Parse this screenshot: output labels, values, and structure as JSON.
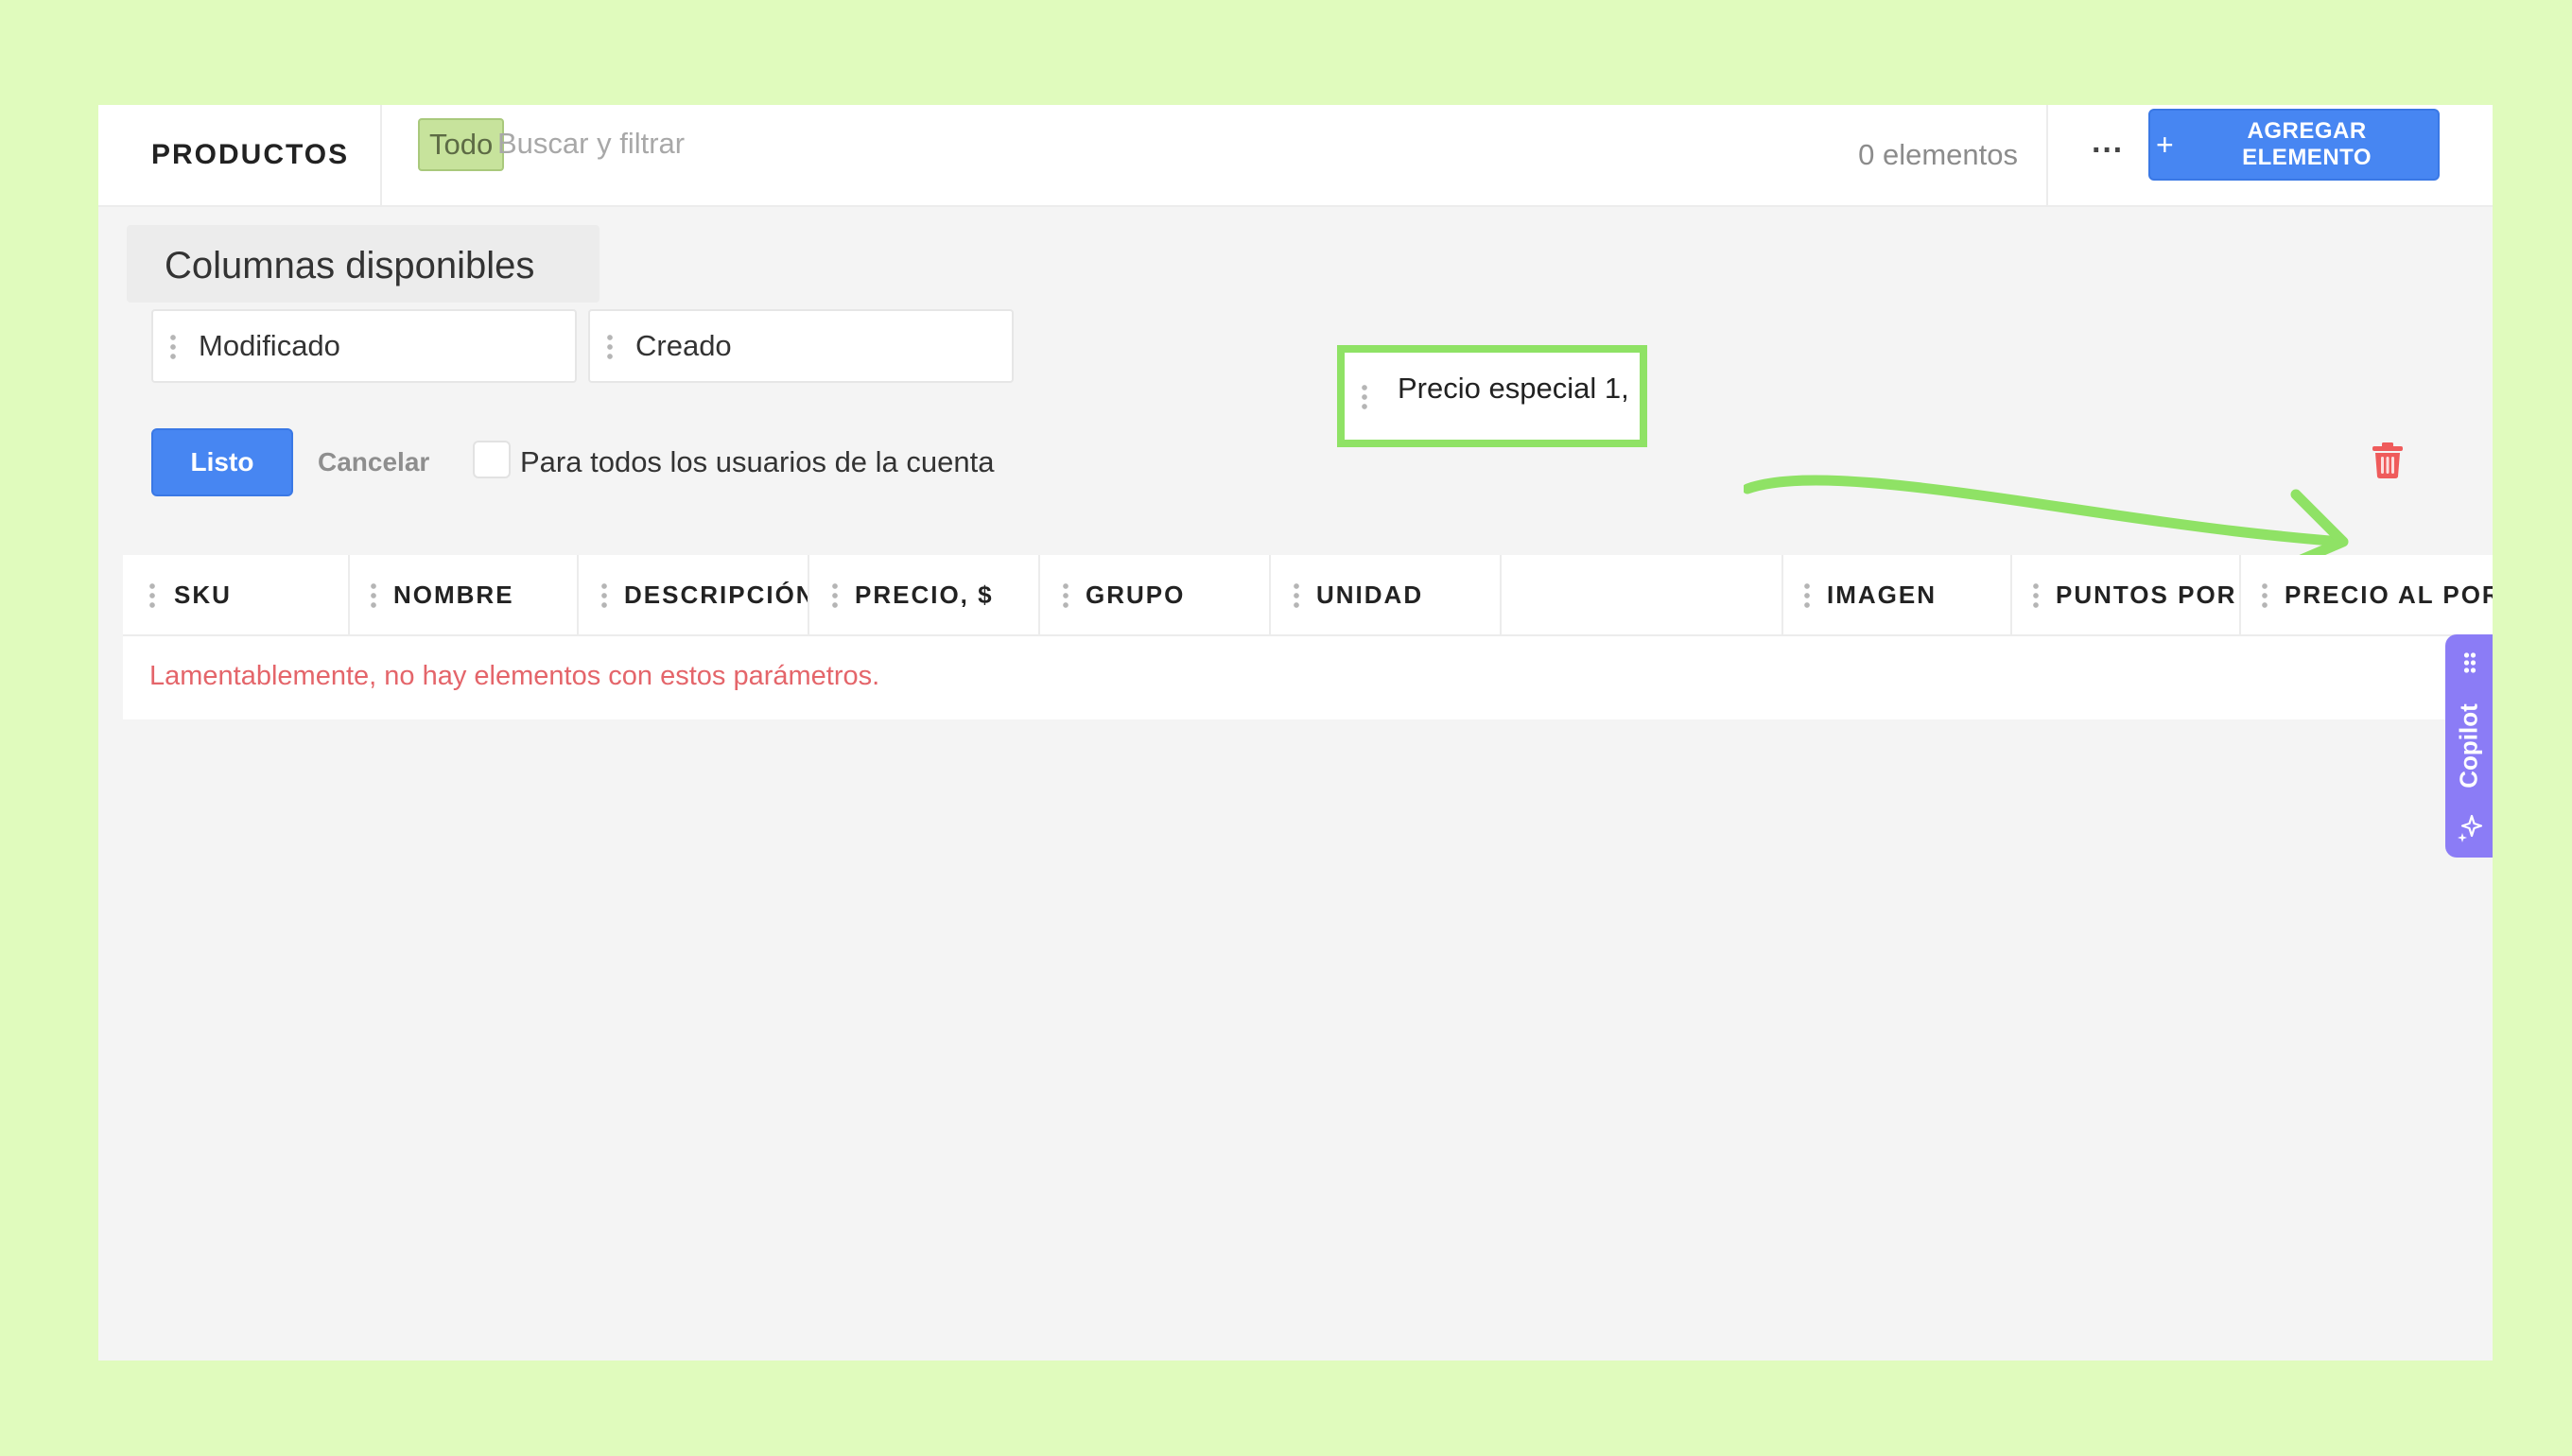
{
  "header": {
    "title": "PRODUCTOS",
    "filter_chip": "Todo",
    "search_placeholder": "Buscar y filtrar",
    "count": "0 elementos",
    "more_label": "···",
    "add_button": "AGREGAR ELEMENTO",
    "add_button_icon": "plus-icon"
  },
  "panel": {
    "title": "Columnas disponibles",
    "available_columns": [
      "Modificado",
      "Creado"
    ],
    "dragging_column": "Precio especial 1,",
    "done_button": "Listo",
    "cancel_button": "Cancelar",
    "all_users_checkbox": {
      "label": "Para todos los usuarios de la cuenta",
      "checked": false
    },
    "trash_icon": "trash-icon"
  },
  "table": {
    "columns": [
      "SKU",
      "NOMBRE",
      "DESCRIPCIÓN",
      "PRECIO, $",
      "GRUPO",
      "UNIDAD",
      "",
      "IMAGEN",
      "PUNTOS POR CO",
      "PRECIO AL POR"
    ],
    "empty_message": "Lamentablemente, no hay elementos con estos parámetros."
  },
  "copilot": {
    "label": "Copilot",
    "icon": "sparkle-icon"
  },
  "colors": {
    "background": "#e0fbbd",
    "primary": "#4786f2",
    "highlight": "#8fe265",
    "error_text": "#e4656a",
    "trash": "#ef5b5b",
    "copilot": "#8b7cf6",
    "chip": "#c7e39c"
  }
}
